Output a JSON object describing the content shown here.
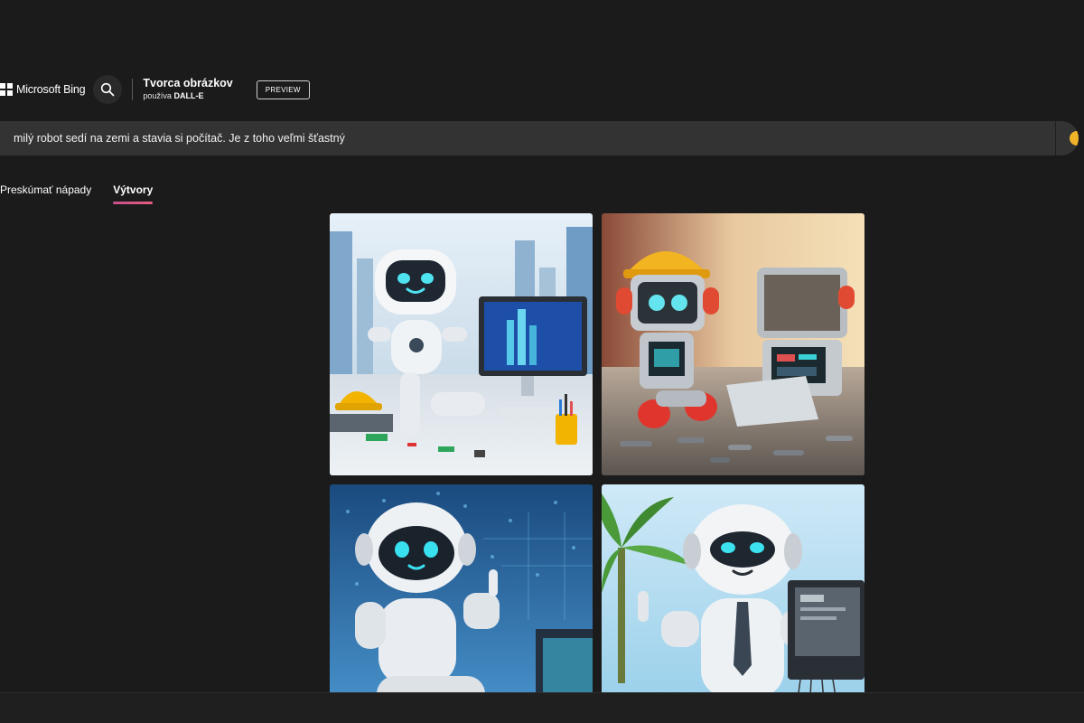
{
  "header": {
    "brand": "Microsoft Bing",
    "product_title": "Tvorca obrázkov",
    "product_sub_prefix": "používa",
    "product_sub_model": "DALL-E",
    "badge": "PREVIEW"
  },
  "prompt": {
    "value": "milý robot sedí na zemi a stavia si počítač. Je z toho veľmi šťastný"
  },
  "tabs": [
    {
      "label": "Preskúmať nápady",
      "active": false
    },
    {
      "label": "Výtvory",
      "active": true
    }
  ],
  "icons": {
    "search": "search-icon",
    "logo": "microsoft-logo-icon"
  },
  "colors": {
    "background": "#1b1b1b",
    "prompt_bar": "#333333",
    "tab_underline": "#d4558a"
  }
}
